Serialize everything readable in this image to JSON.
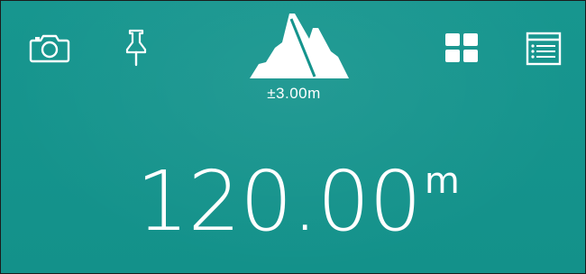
{
  "theme": {
    "background": "#15948d",
    "foreground": "#ffffff"
  },
  "toolbar": {
    "left_icons": [
      "camera-icon",
      "pin-icon"
    ],
    "center_icon": "mountain-icon",
    "right_icons": [
      "grid-icon",
      "list-icon"
    ]
  },
  "reading": {
    "accuracy": "±3.00m",
    "altitude": "120.00",
    "unit": "m"
  }
}
